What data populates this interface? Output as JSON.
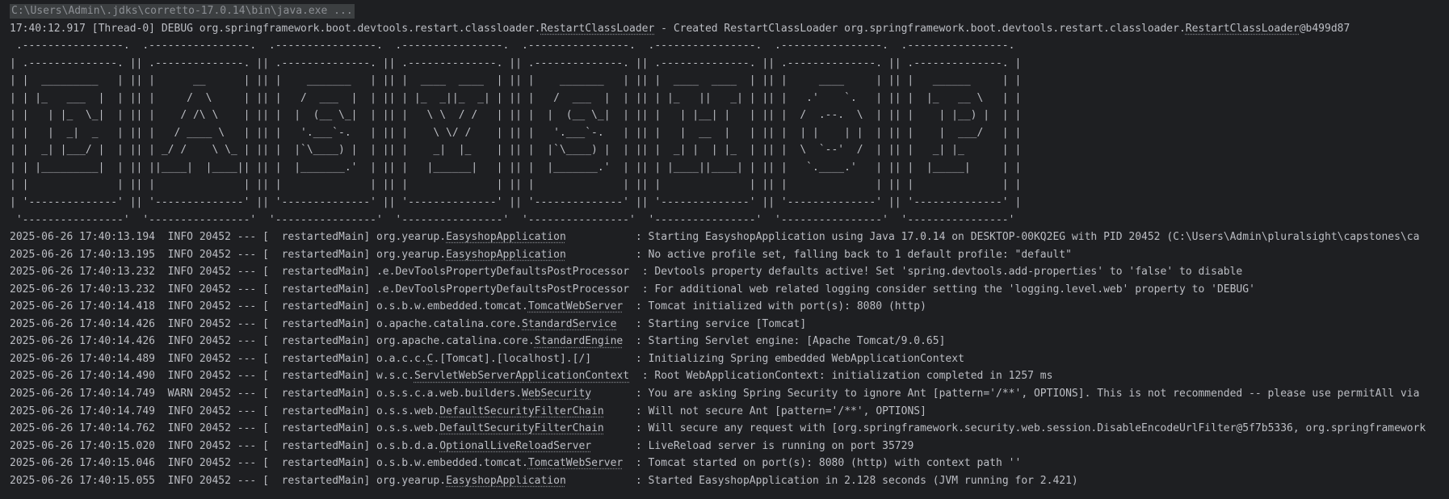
{
  "command": "C:\\Users\\Admin\\.jdks\\corretto-17.0.14\\bin\\java.exe ...",
  "debug_line": {
    "pre": "17:40:12.917 [Thread-0] DEBUG org.springframework.boot.devtools.restart.classloader.",
    "u1": "RestartClassLoader",
    "mid": " - Created RestartClassLoader org.springframework.boot.devtools.restart.classloader.",
    "u2": "RestartClassLoader",
    "post": "@b499d87"
  },
  "banner": [
    " .----------------.  .----------------.  .----------------.  .----------------.  .----------------.  .----------------.  .----------------.  .----------------.",
    "| .--------------. || .--------------. || .--------------. || .--------------. || .--------------. || .--------------. || .--------------. || .--------------. |",
    "| |  _________   | || |      __      | || |    _______   | || |  ____  ____  | || |    _______   | || |  ____  ____  | || |     ____     | || |   ______     | |",
    "| | |_   ___  |  | || |     /  \\     | || |   /  ___  |  | || | |_  _||_  _| | || |   /  ___  |  | || | |_   ||   _| | || |   .'    `.   | || |  |_   __ \\   | |",
    "| |   | |_  \\_|  | || |    / /\\ \\    | || |  |  (__ \\_|  | || |   \\ \\  / /   | || |  |  (__ \\_|  | || |   | |__| |   | || |  /  .--.  \\  | || |    | |__) |  | |",
    "| |   |  _|  _   | || |   / ____ \\   | || |   '.___`-.   | || |    \\ \\/ /    | || |   '.___`-.   | || |   |  __  |   | || |  | |    | |  | || |    |  ___/   | |",
    "| |  _| |___/ |  | || | _/ /    \\ \\_ | || |  |`\\____) |  | || |    _|  |_    | || |  |`\\____) |  | || |  _| |  | |_  | || |  \\  `--'  /  | || |   _| |_      | |",
    "| | |_________|  | || ||____|  |____|| || |  |_______.'  | || |   |______|   | || |  |_______.'  | || | |____||____| | || |   `.____.'   | || |  |_____|     | |",
    "| |              | || |              | || |              | || |              | || |              | || |              | || |              | || |              | |",
    "| '--------------' || '--------------' || '--------------' || '--------------' || '--------------' || '--------------' || '--------------' || '--------------' |",
    " '----------------'  '----------------'  '----------------'  '----------------'  '----------------'  '----------------'  '----------------'  '----------------'"
  ],
  "log_lines": [
    {
      "ts": "2025-06-26 17:40:13.194",
      "level": "INFO",
      "pid": "20452",
      "thread": "restartedMain",
      "lp": "org.yearup.",
      "lu": "EasyshopApplication",
      "ls": "",
      "msg": "Starting EasyshopApplication using Java 17.0.14 on DESKTOP-00KQ2EG with PID 20452 (C:\\Users\\Admin\\pluralsight\\capstones\\ca"
    },
    {
      "ts": "2025-06-26 17:40:13.195",
      "level": "INFO",
      "pid": "20452",
      "thread": "restartedMain",
      "lp": "org.yearup.",
      "lu": "EasyshopApplication",
      "ls": "",
      "msg": "No active profile set, falling back to 1 default profile: \"default\""
    },
    {
      "ts": "2025-06-26 17:40:13.232",
      "level": "INFO",
      "pid": "20452",
      "thread": "restartedMain",
      "lp": ".e.DevToolsPropertyDefaultsPostProcessor",
      "lu": "",
      "ls": "",
      "msg": "Devtools property defaults active! Set 'spring.devtools.add-properties' to 'false' to disable"
    },
    {
      "ts": "2025-06-26 17:40:13.232",
      "level": "INFO",
      "pid": "20452",
      "thread": "restartedMain",
      "lp": ".e.DevToolsPropertyDefaultsPostProcessor",
      "lu": "",
      "ls": "",
      "msg": "For additional web related logging consider setting the 'logging.level.web' property to 'DEBUG'"
    },
    {
      "ts": "2025-06-26 17:40:14.418",
      "level": "INFO",
      "pid": "20452",
      "thread": "restartedMain",
      "lp": "o.s.b.w.embedded.tomcat.",
      "lu": "TomcatWebServer",
      "ls": "",
      "msg": "Tomcat initialized with port(s): 8080 (http)"
    },
    {
      "ts": "2025-06-26 17:40:14.426",
      "level": "INFO",
      "pid": "20452",
      "thread": "restartedMain",
      "lp": "o.apache.catalina.core.",
      "lu": "StandardService",
      "ls": "",
      "msg": "Starting service [Tomcat]"
    },
    {
      "ts": "2025-06-26 17:40:14.426",
      "level": "INFO",
      "pid": "20452",
      "thread": "restartedMain",
      "lp": "org.apache.catalina.core.",
      "lu": "StandardEngine",
      "ls": "",
      "msg": "Starting Servlet engine: [Apache Tomcat/9.0.65]"
    },
    {
      "ts": "2025-06-26 17:40:14.489",
      "level": "INFO",
      "pid": "20452",
      "thread": "restartedMain",
      "lp": "o.a.c.c.",
      "lu": "C",
      "ls": ".[Tomcat].[localhost].[/]",
      "msg": "Initializing Spring embedded WebApplicationContext"
    },
    {
      "ts": "2025-06-26 17:40:14.490",
      "level": "INFO",
      "pid": "20452",
      "thread": "restartedMain",
      "lp": "w.s.c.",
      "lu": "ServletWebServerApplicationContext",
      "ls": "",
      "msg": "Root WebApplicationContext: initialization completed in 1257 ms"
    },
    {
      "ts": "2025-06-26 17:40:14.749",
      "level": "WARN",
      "pid": "20452",
      "thread": "restartedMain",
      "lp": "o.s.s.c.a.web.builders.",
      "lu": "WebSecurity",
      "ls": "",
      "msg": "You are asking Spring Security to ignore Ant [pattern='/**', OPTIONS]. This is not recommended -- please use permitAll via"
    },
    {
      "ts": "2025-06-26 17:40:14.749",
      "level": "INFO",
      "pid": "20452",
      "thread": "restartedMain",
      "lp": "o.s.s.web.",
      "lu": "DefaultSecurityFilterChain",
      "ls": "",
      "msg": "Will not secure Ant [pattern='/**', OPTIONS]"
    },
    {
      "ts": "2025-06-26 17:40:14.762",
      "level": "INFO",
      "pid": "20452",
      "thread": "restartedMain",
      "lp": "o.s.s.web.",
      "lu": "DefaultSecurityFilterChain",
      "ls": "",
      "msg": "Will secure any request with [org.springframework.security.web.session.DisableEncodeUrlFilter@5f7b5336, org.springframework"
    },
    {
      "ts": "2025-06-26 17:40:15.020",
      "level": "INFO",
      "pid": "20452",
      "thread": "restartedMain",
      "lp": "o.s.b.d.a.",
      "lu": "OptionalLiveReloadServer",
      "ls": "",
      "msg": "LiveReload server is running on port 35729"
    },
    {
      "ts": "2025-06-26 17:40:15.046",
      "level": "INFO",
      "pid": "20452",
      "thread": "restartedMain",
      "lp": "o.s.b.w.embedded.tomcat.",
      "lu": "TomcatWebServer",
      "ls": "",
      "msg": "Tomcat started on port(s): 8080 (http) with context path ''"
    },
    {
      "ts": "2025-06-26 17:40:15.055",
      "level": "INFO",
      "pid": "20452",
      "thread": "restartedMain",
      "lp": "org.yearup.",
      "lu": "EasyshopApplication",
      "ls": "",
      "msg": "Started EasyshopApplication in 2.128 seconds (JVM running for 2.421)"
    }
  ]
}
